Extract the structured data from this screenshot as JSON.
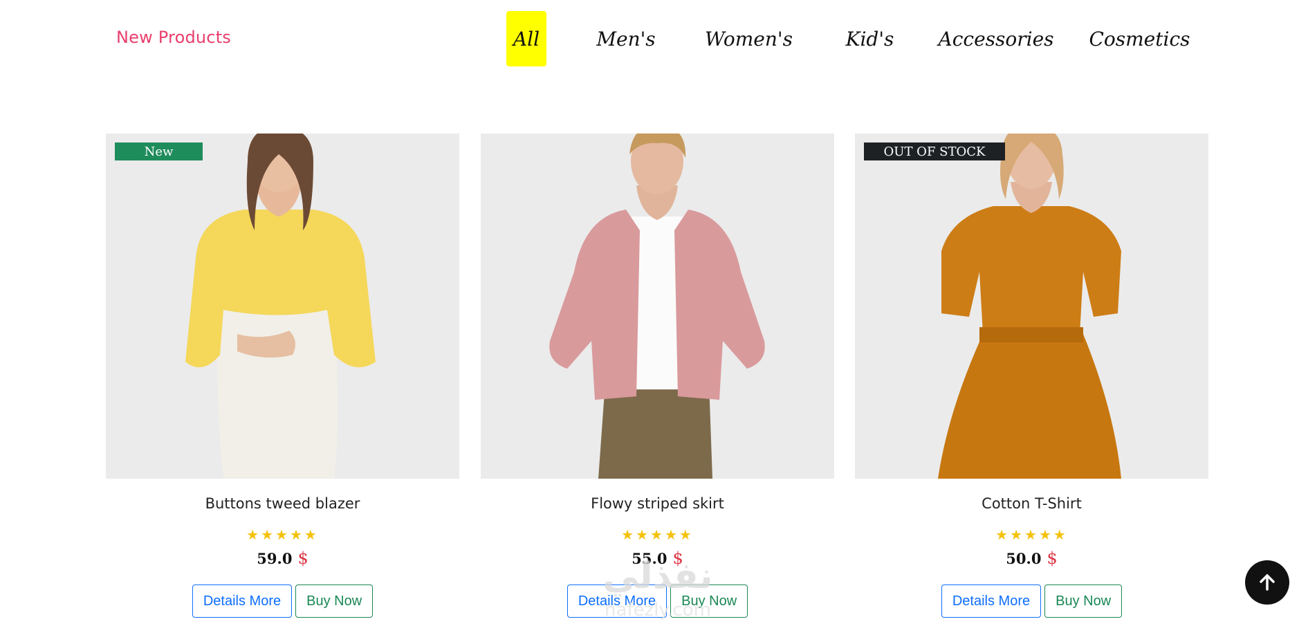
{
  "section": {
    "title": "New Products"
  },
  "tabs": [
    {
      "label": "All",
      "active": true
    },
    {
      "label": "Men's"
    },
    {
      "label": "Women's"
    },
    {
      "label": "Kid's"
    },
    {
      "label": "Accessories"
    },
    {
      "label": "Cosmetics"
    }
  ],
  "products": [
    {
      "name": "Buttons tweed blazer",
      "price": "59.0",
      "currency": "$",
      "rating": 5,
      "stars": "★★★★★",
      "badge": "New",
      "details_label": "Details More",
      "buy_label": "Buy Now",
      "image": "woman-yellow-blouse-photo"
    },
    {
      "name": "Flowy striped skirt",
      "price": "55.0",
      "currency": "$",
      "rating": 5,
      "stars": "★★★★★",
      "badge": "",
      "details_label": "Details More",
      "buy_label": "Buy Now",
      "image": "man-pink-shirt-photo"
    },
    {
      "name": "Cotton T-Shirt",
      "price": "50.0",
      "currency": "$",
      "rating": 5,
      "stars": "★★★★★",
      "badge": "OUT OF STOCK",
      "details_label": "Details More",
      "buy_label": "Buy Now",
      "image": "woman-orange-dress-photo"
    }
  ],
  "watermark": {
    "text_ar": "نفذلي",
    "text_en": "nafezly.com"
  },
  "back_to_top": {
    "icon": "arrow-up-icon"
  },
  "colors": {
    "accent_pink": "#e83e6c",
    "tab_active": "#ffff00",
    "badge_new": "#1f8c5b",
    "badge_oos": "#1e2124",
    "primary": "#0d6efd",
    "success": "#198754",
    "price_currency": "#dc3545",
    "star": "#f4c20d"
  }
}
